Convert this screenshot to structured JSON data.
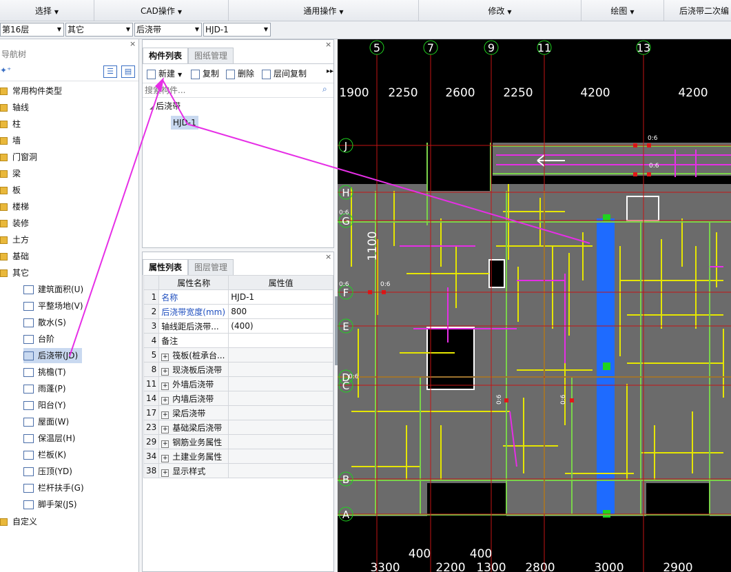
{
  "menubar": {
    "items": [
      "选择",
      "CAD操作",
      "通用操作",
      "修改",
      "绘图",
      "后浇带二次编"
    ]
  },
  "combos": {
    "floor": "第16层",
    "category": "其它",
    "type": "后浇带",
    "component": "HJD-1"
  },
  "nav": {
    "title": "导航树",
    "top_items": [
      "常用构件类型",
      "轴线",
      "柱",
      "墙",
      "门窗洞",
      "梁",
      "板",
      "楼梯",
      "装修",
      "土方",
      "基础",
      "其它"
    ],
    "sub_items": [
      "建筑面积(U)",
      "平整场地(V)",
      "散水(S)",
      "台阶",
      "后浇带(JD)",
      "挑檐(T)",
      "雨蓬(P)",
      "阳台(Y)",
      "屋面(W)",
      "保温层(H)",
      "栏板(K)",
      "压顶(YD)",
      "栏杆扶手(G)",
      "脚手架(JS)"
    ],
    "bottom_item": "自定义"
  },
  "component_list": {
    "tabs": [
      "构件列表",
      "图纸管理"
    ],
    "toolbar": {
      "new": "新建",
      "copy": "复制",
      "delete": "删除",
      "floor_copy": "层间复制"
    },
    "search_placeholder": "搜索构件...",
    "tree_root": "后浇带",
    "tree_child": "HJD-1"
  },
  "properties": {
    "tabs": [
      "属性列表",
      "图层管理"
    ],
    "header": {
      "name": "属性名称",
      "value": "属性值"
    },
    "rows": [
      {
        "no": "1",
        "name": "名称",
        "value": "HJD-1"
      },
      {
        "no": "2",
        "name": "后浇带宽度(mm)",
        "value": "800"
      },
      {
        "no": "3",
        "name": "轴线距后浇带...",
        "value": "(400)"
      },
      {
        "no": "4",
        "name": "备注",
        "value": ""
      },
      {
        "no": "5",
        "name": "筏板(桩承台...",
        "value": ""
      },
      {
        "no": "8",
        "name": "现浇板后浇带",
        "value": ""
      },
      {
        "no": "11",
        "name": "外墙后浇带",
        "value": ""
      },
      {
        "no": "14",
        "name": "内墙后浇带",
        "value": ""
      },
      {
        "no": "17",
        "name": "梁后浇带",
        "value": ""
      },
      {
        "no": "23",
        "name": "基础梁后浇带",
        "value": ""
      },
      {
        "no": "29",
        "name": "钢筋业务属性",
        "value": ""
      },
      {
        "no": "34",
        "name": "土建业务属性",
        "value": ""
      },
      {
        "no": "38",
        "name": "显示样式",
        "value": ""
      }
    ]
  },
  "cad": {
    "axis_top": [
      "5",
      "7",
      "9",
      "11",
      "13"
    ],
    "dims_top": [
      "1900",
      "2250",
      "2600",
      "2250",
      "4200",
      "4200"
    ],
    "axis_left": [
      "J",
      "H",
      "G",
      "F",
      "E",
      "D",
      "C",
      "B",
      "A"
    ],
    "dim_vertical": "1100",
    "dims_bottom_upper": [
      "400",
      "400"
    ],
    "dims_bottom": [
      "3300",
      "2200",
      "1300",
      "2800",
      "3000",
      "2900"
    ],
    "small_labels": [
      "0:6",
      "0:6",
      "0:6",
      "0:6",
      "0:6",
      "0:6",
      "0:6",
      "0:6"
    ],
    "colors": {
      "background": "#000000",
      "axis": "#c41414",
      "wall": "#e6e600",
      "slab": "#6b6b6b",
      "band": "#1e6bff",
      "arrow": "#e62ee6"
    }
  }
}
